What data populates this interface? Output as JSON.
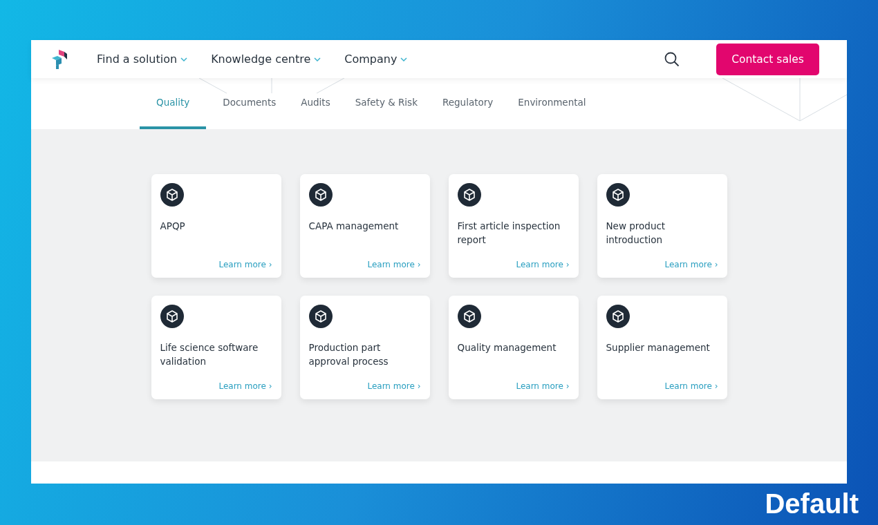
{
  "nav": {
    "items": [
      {
        "label": "Find a solution"
      },
      {
        "label": "Knowledge centre"
      },
      {
        "label": "Company"
      }
    ],
    "cta": "Contact sales"
  },
  "tabs": [
    {
      "label": "Quality",
      "selected": true
    },
    {
      "label": "Documents",
      "selected": false
    },
    {
      "label": "Audits",
      "selected": false
    },
    {
      "label": "Safety & Risk",
      "selected": false
    },
    {
      "label": "Regulatory",
      "selected": false
    },
    {
      "label": "Environmental",
      "selected": false
    }
  ],
  "cards": [
    {
      "title": "APQP",
      "link": "Learn more ›"
    },
    {
      "title": "CAPA management",
      "link": "Learn more ›"
    },
    {
      "title": "First article inspection report",
      "link": "Learn more ›"
    },
    {
      "title": "New product introduction",
      "link": "Learn more ›"
    },
    {
      "title": "Life science software validation",
      "link": "Learn more ›"
    },
    {
      "title": "Production part approval process",
      "link": "Learn more ›"
    },
    {
      "title": "Quality management",
      "link": "Learn more ›"
    },
    {
      "title": "Supplier management",
      "link": "Learn more ›"
    }
  ],
  "caption": "Default"
}
